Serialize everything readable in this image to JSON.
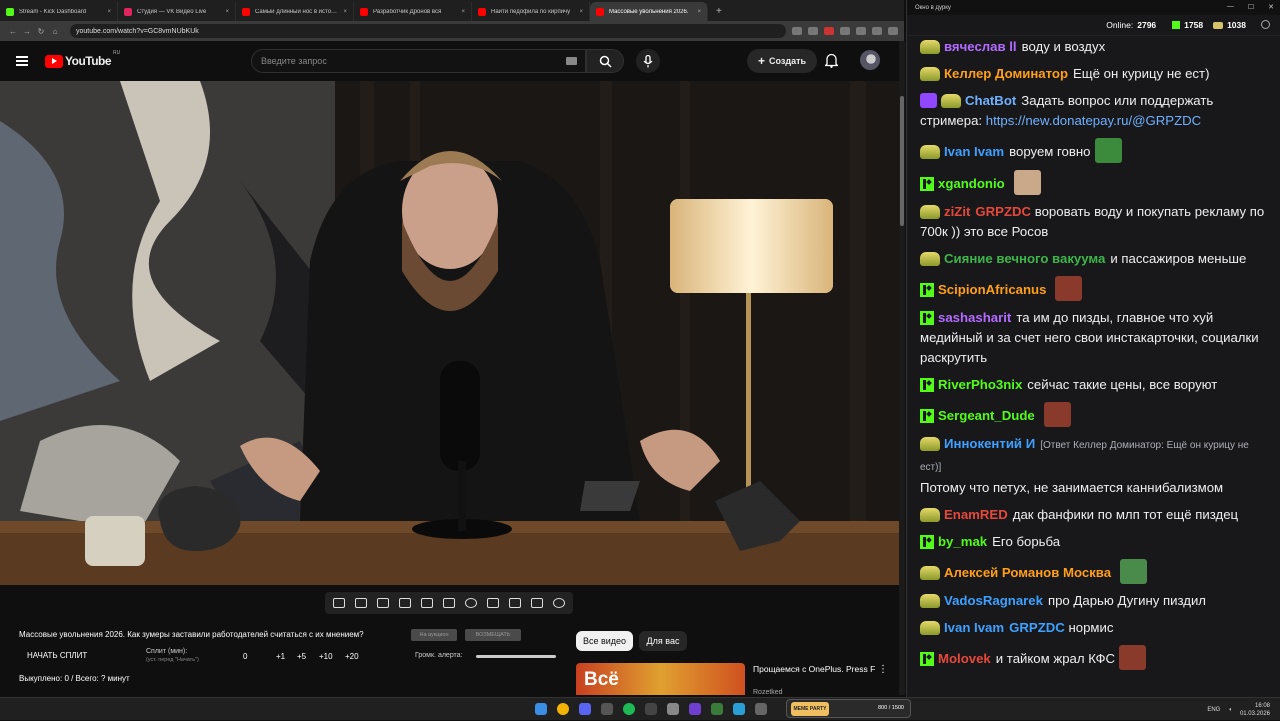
{
  "browser": {
    "tabs": [
      {
        "title": "Stream - Kick Dashboard",
        "color": "#53fc18"
      },
      {
        "title": "Студия — VK Видео Live",
        "color": "#e0245e"
      },
      {
        "title": "Самый длинный нос в истории",
        "color": "#ff0000"
      },
      {
        "title": "Разработчик Дронов вся",
        "color": "#ff0000"
      },
      {
        "title": "Найти педофила по кирпичу",
        "color": "#ff0000"
      },
      {
        "title": "Массовые увольнения 2026.",
        "color": "#ff0000"
      }
    ],
    "new_tab": "+",
    "url": "youtube.com/watch?v=GC8vmNUbKUk"
  },
  "youtube": {
    "logo": "YouTube",
    "region": "RU",
    "search_placeholder": "Введите запрос",
    "create_label": "Создать",
    "video_title": "Массовые увольнения 2026. Как зумеры заставили работодателей считаться с их мнением?",
    "pill_1": "На аукцион",
    "pill_2": "ВОЗМЕЩАТЬ",
    "split_button": "НАЧАТЬ СПЛИТ",
    "split_label": "Сплит (мин):",
    "split_hint": "(уст. перед \"Начать\")",
    "split_values": [
      "0",
      "+1",
      "+5",
      "+10",
      "+20"
    ],
    "alert_volume_label": "Громк. алерта:",
    "alert_volume": 1,
    "stats": "Выкуплено: 0 / Всего: ? минут",
    "chips": [
      "Все видео",
      "Для вас"
    ],
    "rec_thumb_text": "Всё",
    "rec_title": "Прощаемся с OnePlus. Press F",
    "rec_channel": "Rozetked"
  },
  "chat": {
    "window_title": "Окно в дурку",
    "online_label": "Online:",
    "online": "2796",
    "kick_count": "1758",
    "sub_count": "1038",
    "messages": [
      {
        "badge": "sub",
        "user": "вячеслав ll",
        "color": "#b36bff",
        "text": "воду и воздух"
      },
      {
        "badge": "sub",
        "user": "Келлер Доминатор",
        "color": "#ff9f1a",
        "text": "Ещё он курицу не ест)"
      },
      {
        "badge": "bot",
        "user": "ChatBot",
        "color": "#6fb1ff",
        "text": "Задать вопрос или поддержать стримера:",
        "link": "https://new.donatepay.ru/@GRPZDC"
      },
      {
        "badge": "sub",
        "user": "Ivan Ivam",
        "color": "#3ea0ff",
        "text": "воруем говно",
        "emote": "#3c8a3c"
      },
      {
        "badge": "kick",
        "user": "xgandonio",
        "color": "#53fc18",
        "text": "",
        "emote": "#c9a98a"
      },
      {
        "badge": "sub",
        "user": "ziZit",
        "color": "#e6483b",
        "tag": "GRPZDC",
        "text": "воровать воду и покупать рекламу по 700к  )) это все Росов"
      },
      {
        "badge": "sub",
        "user": "Сияние вечного вакуума",
        "color": "#3eb54a",
        "text": "и пассажиров меньше"
      },
      {
        "badge": "kick",
        "user": "ScipionAfricanus",
        "color": "#ff9f1a",
        "text": "",
        "emote": "#8a3a2a"
      },
      {
        "badge": "kick",
        "user": "sashasharit",
        "color": "#b36bff",
        "text": "та им до пизды, главное что хуй медийный и за счет него свои инстакарточки, социалки раскрутить"
      },
      {
        "badge": "kick",
        "user": "RiverPho3nix",
        "color": "#53fc18",
        "text": "сейчас такие цены, все воруют"
      },
      {
        "badge": "kick",
        "user": "Sergeant_Dude",
        "color": "#53fc18",
        "text": "",
        "emote": "#8a3a2a"
      },
      {
        "badge": "sub",
        "user": "Иннокентий И",
        "color": "#3ea0ff",
        "reply": "[Ответ Келлер Доминатор: Ещё он курицу не ест)]",
        "text": "Потому что петух, не занимается каннибализмом"
      },
      {
        "badge": "sub",
        "user": "EnamRED",
        "color": "#e6483b",
        "text": "дак фанфики по млп тот ещё пиздец"
      },
      {
        "badge": "kick",
        "user": "by_mak",
        "color": "#53fc18",
        "text": "Его борьба"
      },
      {
        "badge": "sub",
        "user": "Алексей Романов Москва",
        "color": "#ff9f1a",
        "text": "",
        "emote": "#4a8a4a"
      },
      {
        "badge": "sub",
        "user": "VadosRagnarek",
        "color": "#3ea0ff",
        "text": "про Дарью Дугину пиздил"
      },
      {
        "badge": "sub",
        "user": "Ivan Ivam",
        "color": "#3ea0ff",
        "tag": "GRPZDC",
        "tag_color": "#3ea0ff",
        "text": "нормис"
      },
      {
        "badge": "kick",
        "user": "Molovek",
        "color": "#e6483b",
        "text": "и тайком жрал КФС",
        "emote": "#8a3a2a"
      }
    ]
  },
  "taskbar": {
    "meme_label": "MEME PARTY",
    "meme_count": "800 / 1500",
    "lang": "ENG",
    "time": "16:08",
    "date": "01.03.2026"
  }
}
